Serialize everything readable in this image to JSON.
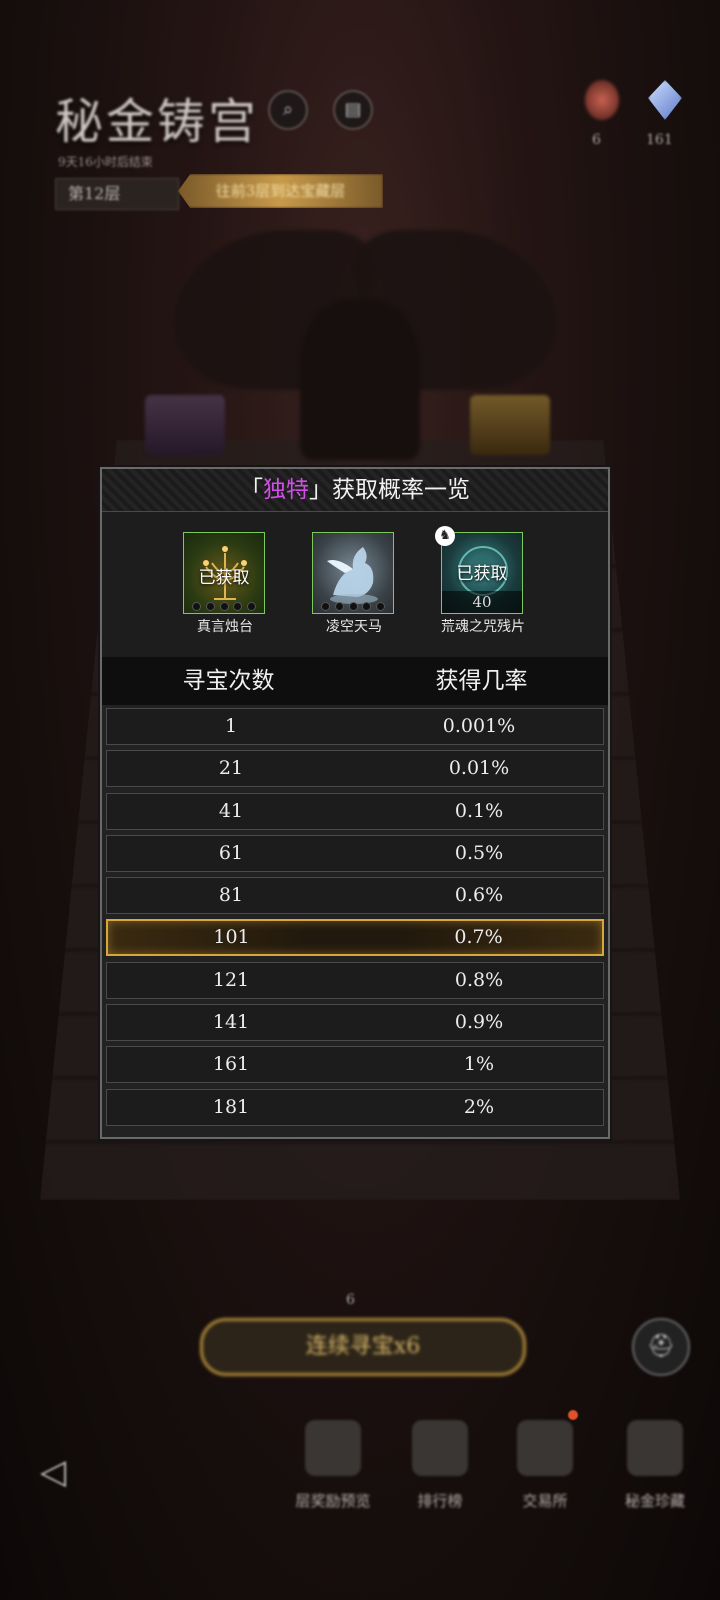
{
  "background": {
    "title": "秘金铸宫",
    "subtitle": "9天16小时后结束",
    "floor": "第12层",
    "floor_hint": "往前3层到达宝藏层",
    "resource_a": "6",
    "resource_b": "161",
    "streak_count": "6",
    "streak_button": "连续寻宝x6",
    "nav": [
      "层奖励预览",
      "排行榜",
      "交易所",
      "秘金珍藏"
    ]
  },
  "dialog": {
    "title_bracket_open": "「",
    "title_highlight": "独特",
    "title_bracket_close": "」",
    "title_rest": "获取概率一览",
    "items": [
      {
        "name": "真言烛台",
        "status": "已获取",
        "icon": "candelabra-icon"
      },
      {
        "name": "凌空天马",
        "status": "",
        "icon": "pegasus-icon"
      },
      {
        "name": "荒魂之咒残片",
        "status": "已获取",
        "count": "40",
        "icon": "orb-icon"
      }
    ],
    "columns": [
      "寻宝次数",
      "获得几率"
    ],
    "rows": [
      {
        "count": "1",
        "rate": "0.001%"
      },
      {
        "count": "21",
        "rate": "0.01%"
      },
      {
        "count": "41",
        "rate": "0.1%"
      },
      {
        "count": "61",
        "rate": "0.5%"
      },
      {
        "count": "81",
        "rate": "0.6%"
      },
      {
        "count": "101",
        "rate": "0.7%"
      },
      {
        "count": "121",
        "rate": "0.8%"
      },
      {
        "count": "141",
        "rate": "0.9%"
      },
      {
        "count": "161",
        "rate": "1%"
      },
      {
        "count": "181",
        "rate": "2%"
      }
    ],
    "active_row_index": 5
  },
  "colors": {
    "highlight": "#cf4fe6",
    "item_border": "#7acb5a",
    "active_row_border": "#d7a73e"
  }
}
